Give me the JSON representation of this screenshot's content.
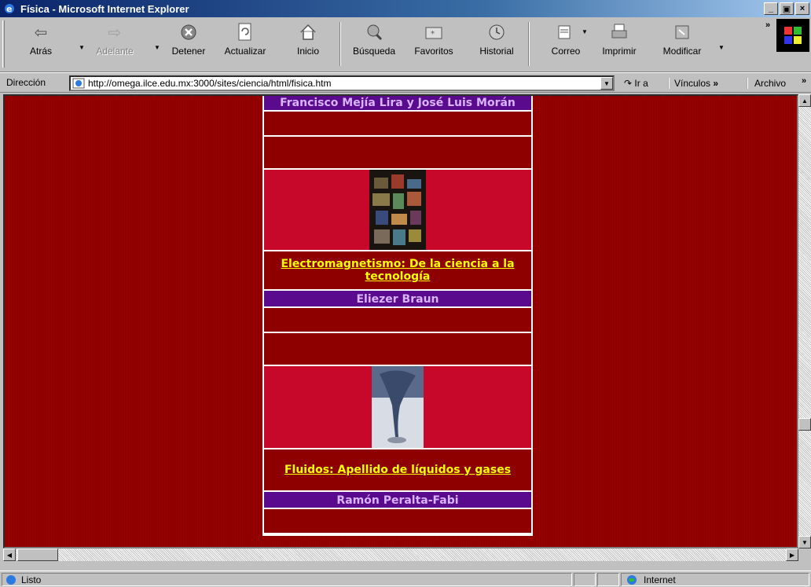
{
  "window": {
    "title": "Física - Microsoft Internet Explorer",
    "controls": [
      "_",
      "▫",
      "×"
    ]
  },
  "toolbar": {
    "back": "Atrás",
    "forward": "Adelante",
    "stop": "Detener",
    "refresh": "Actualizar",
    "home": "Inicio",
    "search": "Búsqueda",
    "favorites": "Favoritos",
    "history": "Historial",
    "mail": "Correo",
    "print": "Imprimir",
    "edit": "Modificar"
  },
  "address": {
    "label": "Dirección",
    "url": "http://omega.ilce.edu.mx:3000/sites/ciencia/html/fisica.htm",
    "go": "Ir a",
    "links": "Vínculos",
    "file": "Archivo"
  },
  "books": [
    {
      "author": "Francisco Mejía Lira y José Luis Morán"
    },
    {
      "title": "Electromagnetismo: De la ciencia a la tecnología",
      "author": "Eliezer Braun"
    },
    {
      "title": "Fluidos: Apellido de líquidos y gases",
      "author": "Ramón Peralta-Fabi"
    }
  ],
  "status": {
    "text": "Listo",
    "zone": "Internet"
  },
  "colors": {
    "background": "#8e0000",
    "image_cell": "#c8082a",
    "author_band": "#5a0a8c",
    "author_text": "#d8b4ff",
    "title_link": "#ffff00"
  }
}
